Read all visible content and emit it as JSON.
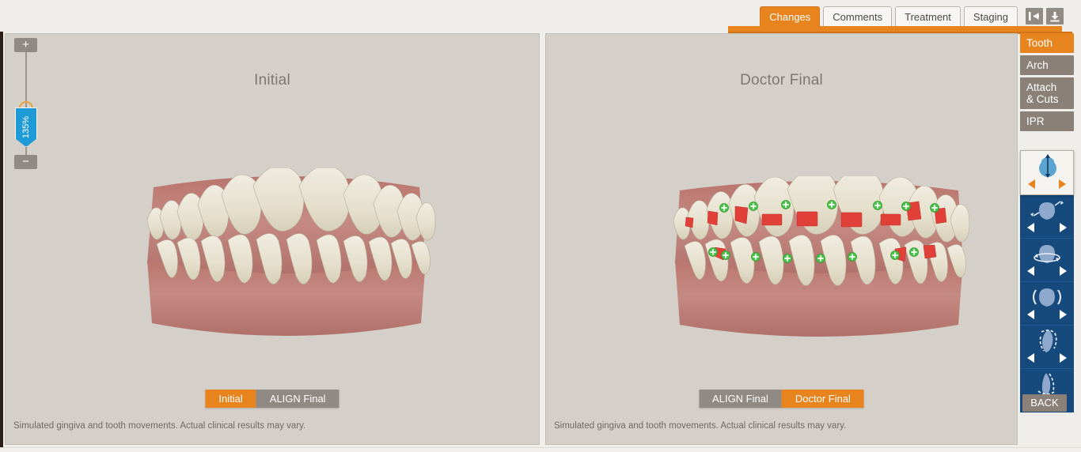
{
  "header": {
    "tabs": [
      {
        "label": "Changes",
        "active": true
      },
      {
        "label": "Comments",
        "active": false
      },
      {
        "label": "Treatment",
        "active": false
      },
      {
        "label": "Staging",
        "active": false
      }
    ],
    "icons": [
      {
        "name": "collapse-panel-icon",
        "glyph": "|←"
      },
      {
        "name": "download-icon",
        "glyph": "↓"
      }
    ],
    "accent_color": "#e8841e"
  },
  "zoom_control": {
    "value_label": "135%",
    "increase_label": "+",
    "decrease_label": "−",
    "handle_color": "#1e9ad6"
  },
  "panels": [
    {
      "id": "initial",
      "title": "Initial",
      "toggles": [
        {
          "label": "Initial",
          "active": true
        },
        {
          "label": "ALIGN Final",
          "active": false
        }
      ],
      "disclaimer": "Simulated gingiva and tooth movements. Actual clinical results may vary.",
      "model": {
        "gingiva_color": "#c08078",
        "tooth_color": "#e8e2d0",
        "has_attachments": false,
        "has_ipr_markers": false
      }
    },
    {
      "id": "doctor-final",
      "title": "Doctor Final",
      "toggles": [
        {
          "label": "ALIGN Final",
          "active": false
        },
        {
          "label": "Doctor Final",
          "active": true
        }
      ],
      "disclaimer": "Simulated gingiva and tooth movements. Actual clinical results may vary.",
      "model": {
        "gingiva_color": "#c08078",
        "tooth_color": "#e8e2d0",
        "has_attachments": true,
        "has_ipr_markers": true,
        "attachment_color": "#e04038",
        "ipr_marker_color": "#4cc24c"
      }
    }
  ],
  "sidebar": {
    "categories": [
      {
        "label": "Tooth",
        "active": true
      },
      {
        "label": "Arch",
        "active": false
      },
      {
        "label": "Attach\n& Cuts",
        "active": false
      },
      {
        "label": "IPR",
        "active": false
      }
    ],
    "tools": [
      {
        "name": "extrusion-intrusion-tool",
        "selected": true
      },
      {
        "name": "mesial-distal-tool",
        "selected": false
      },
      {
        "name": "rotation-tool",
        "selected": false
      },
      {
        "name": "buccal-lingual-tool",
        "selected": false
      },
      {
        "name": "angulation-tip-tool",
        "selected": false
      },
      {
        "name": "torque-inclination-tool",
        "selected": false
      }
    ],
    "back_label": "BACK"
  }
}
